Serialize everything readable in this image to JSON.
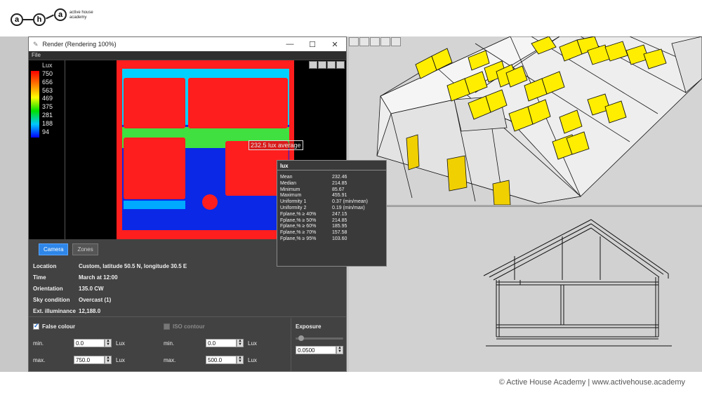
{
  "brand": {
    "letters": [
      "a",
      "h",
      "a"
    ],
    "line1": "active house",
    "line2": "academy"
  },
  "window": {
    "title": "Render (Rendering 100%)",
    "menu": "File",
    "minimize": "—",
    "maximize": "☐",
    "close": "✕"
  },
  "legend": {
    "unit": "Lux",
    "ticks": [
      "750",
      "656",
      "563",
      "469",
      "375",
      "281",
      "188",
      "94"
    ]
  },
  "overlay": {
    "average_tag": "232.5 lux average"
  },
  "tabs": {
    "camera": "Camera",
    "zones": "Zones"
  },
  "info": [
    {
      "key": "Location",
      "value": "Custom, latitude 50.5 N, longitude 30.5 E"
    },
    {
      "key": "Time",
      "value": "March at 12:00"
    },
    {
      "key": "Orientation",
      "value": "135.0 CW"
    },
    {
      "key": "Sky condition",
      "value": "Overcast (1)"
    },
    {
      "key": "Ext. illuminance",
      "value": "12,188.0"
    }
  ],
  "false_colour": {
    "label": "False colour",
    "checked": true,
    "min_label": "min.",
    "min_value": "0.0",
    "max_label": "max.",
    "max_value": "750.0",
    "unit": "Lux"
  },
  "iso_contour": {
    "label": "ISO contour",
    "checked": false,
    "min_label": "min.",
    "min_value": "0.0",
    "max_label": "max.",
    "max_value": "500.0",
    "unit": "Lux"
  },
  "exposure": {
    "label": "Exposure",
    "value": "0.0500",
    "slider_fraction": 0.05
  },
  "stats": {
    "title": "lux",
    "rows": [
      {
        "key": "Mean",
        "value": "232.46"
      },
      {
        "key": "Median",
        "value": "214.85"
      },
      {
        "key": "Minimum",
        "value": "85.67"
      },
      {
        "key": "Maximum",
        "value": "455.91"
      },
      {
        "key": "Uniformity 1",
        "value": "0.37 (min/mean)"
      },
      {
        "key": "Uniformity 2",
        "value": "0.19 (min/max)"
      },
      {
        "key": "Fplane,% ≥ 40%",
        "value": "247.15"
      },
      {
        "key": "Fplane,% ≥ 50%",
        "value": "214.85"
      },
      {
        "key": "Fplane,% ≥ 60%",
        "value": "185.95"
      },
      {
        "key": "Fplane,% ≥ 70%",
        "value": "157.58"
      },
      {
        "key": "Fplane,% ≥ 95%",
        "value": "103.60"
      }
    ]
  },
  "footer": "© Active House Academy | www.activehouse.academy",
  "colors": {
    "accent": "#2e86e8",
    "window_yellow": "#ffee00",
    "heat_red": "#ff1e1e",
    "heat_blue": "#0a28e6"
  }
}
